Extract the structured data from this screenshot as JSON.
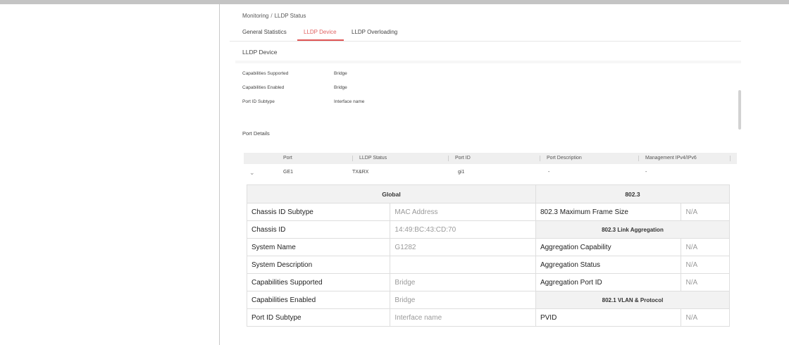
{
  "breadcrumb": {
    "parent": "Monitoring",
    "separator": "/",
    "current": "LLDP Status"
  },
  "tabs": [
    "General Statistics",
    "LLDP Device",
    "LLDP Overloading"
  ],
  "active_tab": "LLDP Device",
  "section_title": "LLDP Device",
  "device_info": [
    {
      "label": "Capabilities Supported",
      "value": "Bridge"
    },
    {
      "label": "Capabilities Enabled",
      "value": "Bridge"
    },
    {
      "label": "Port ID Subtype",
      "value": "Interface name"
    }
  ],
  "port_details_title": "Port Details",
  "port_table": {
    "columns": [
      "Port",
      "LLDP Status",
      "Port ID",
      "Port Description",
      "Management IPv4/IPv6"
    ],
    "row": {
      "port": "GE1",
      "status": "TX&RX",
      "port_id": "gi1",
      "description": "-",
      "management": "-"
    }
  },
  "detail": {
    "global_header": "Global",
    "ieee_header": "802.3",
    "rows": [
      {
        "label": "Chassis ID Subtype",
        "value": "MAC Address",
        "r_label": "802.3 Maximum Frame Size",
        "r_value": "N/A"
      },
      {
        "label": "Chassis ID",
        "value": "14:49:BC:43:CD:70",
        "r_section": "802.3 Link Aggregation"
      },
      {
        "label": "System Name",
        "value": "G1282",
        "r_label": "Aggregation Capability",
        "r_value": "N/A"
      },
      {
        "label": "System Description",
        "value": "",
        "r_label": "Aggregation Status",
        "r_value": "N/A"
      },
      {
        "label": "Capabilities Supported",
        "value": "Bridge",
        "r_label": "Aggregation Port ID",
        "r_value": "N/A"
      },
      {
        "label": "Capabilities Enabled",
        "value": "Bridge",
        "r_section": "802.1 VLAN & Protocol"
      },
      {
        "label": "Port ID Subtype",
        "value": "Interface name",
        "r_label": "PVID",
        "r_value": "N/A"
      }
    ]
  },
  "colors": {
    "accent": "#e05555",
    "muted_value": "#9a9a9a",
    "header_bg": "#f2f2f2"
  }
}
